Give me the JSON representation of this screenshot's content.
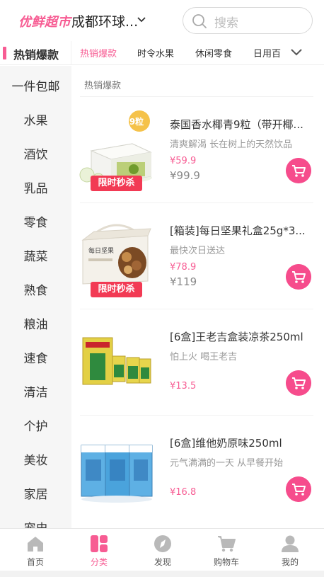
{
  "header": {
    "brand": "优鲜超市",
    "city": "成都环球...",
    "search_placeholder": "搜索"
  },
  "tabbar": {
    "current_category": "热销爆款",
    "tabs": [
      "热销爆款",
      "时令水果",
      "休闲零食",
      "日用百"
    ]
  },
  "sidebar": {
    "items": [
      "一件包邮",
      "水果",
      "酒饮",
      "乳品",
      "零食",
      "蔬菜",
      "熟食",
      "粮油",
      "速食",
      "清洁",
      "个护",
      "美妆",
      "家居",
      "宠史"
    ]
  },
  "main": {
    "section_title": "热销爆款",
    "products": [
      {
        "name": "泰国香水椰青9粒（带开椰...",
        "subtitle": "清爽解渴 长在树上的天然饮品",
        "price": "¥59.9",
        "original_price": "¥99.9",
        "badge": "限时秒杀",
        "pack_label": "9粒"
      },
      {
        "name": "[箱装]每日坚果礼盒25g*3...",
        "subtitle": "最快次日送达",
        "price": "¥78.9",
        "original_price": "¥119",
        "badge": "限时秒杀",
        "box_label": "每日坚果"
      },
      {
        "name": "[6盒]王老吉盒装凉茶250ml",
        "subtitle": "怕上火 喝王老吉",
        "price": "¥13.5"
      },
      {
        "name": "[6盒]维他奶原味250ml",
        "subtitle": "元气满满的一天 从早餐开始",
        "price": "¥16.8"
      }
    ]
  },
  "bottom_nav": {
    "items": [
      {
        "label": "首页",
        "icon": "home-icon"
      },
      {
        "label": "分类",
        "icon": "category-icon"
      },
      {
        "label": "发现",
        "icon": "compass-icon"
      },
      {
        "label": "购物车",
        "icon": "cart-icon"
      },
      {
        "label": "我的",
        "icon": "user-icon"
      }
    ],
    "active": "分类"
  },
  "colors": {
    "accent": "#f75c93",
    "flash_badge": "#f23a54",
    "sidebar_bg": "#f6f6f6"
  }
}
